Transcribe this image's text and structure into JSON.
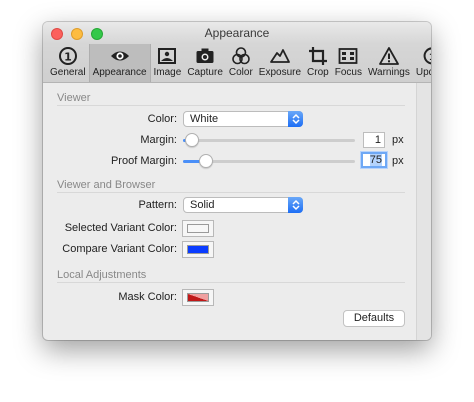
{
  "window": {
    "title": "Appearance"
  },
  "toolbar": {
    "tabs": [
      {
        "label": "General",
        "icon": "info-circle-icon",
        "selected": false
      },
      {
        "label": "Appearance",
        "icon": "eye-icon",
        "selected": true
      },
      {
        "label": "Image",
        "icon": "image-icon",
        "selected": false
      },
      {
        "label": "Capture",
        "icon": "camera-icon",
        "selected": false
      },
      {
        "label": "Color",
        "icon": "color-circles-icon",
        "selected": false
      },
      {
        "label": "Exposure",
        "icon": "exposure-icon",
        "selected": false
      },
      {
        "label": "Crop",
        "icon": "crop-icon",
        "selected": false
      },
      {
        "label": "Focus",
        "icon": "focus-icon",
        "selected": false
      },
      {
        "label": "Warnings",
        "icon": "warning-icon",
        "selected": false
      },
      {
        "label": "Update",
        "icon": "update-icon",
        "selected": false
      }
    ]
  },
  "viewer": {
    "header": "Viewer",
    "color_label": "Color:",
    "color_value": "White",
    "margin_label": "Margin:",
    "margin_value": "1",
    "margin_slider_fraction": 0.01,
    "margin_unit": "px",
    "proof_margin_label": "Proof Margin:",
    "proof_margin_value": "75",
    "proof_margin_slider_fraction": 0.1,
    "proof_margin_unit": "px"
  },
  "viewer_browser": {
    "header": "Viewer and Browser",
    "pattern_label": "Pattern:",
    "pattern_value": "Solid",
    "selected_variant_label": "Selected Variant Color:",
    "selected_variant_color": "#f7f7f7",
    "compare_variant_label": "Compare Variant Color:",
    "compare_variant_color": "#0a3cff"
  },
  "local_adjustments": {
    "header": "Local Adjustments",
    "mask_label": "Mask Color:",
    "mask_color": "#c01818"
  },
  "footer": {
    "defaults_label": "Defaults"
  },
  "colors": {
    "accent": "#1d6ef5",
    "slider_fill": "#4a8ff8"
  }
}
